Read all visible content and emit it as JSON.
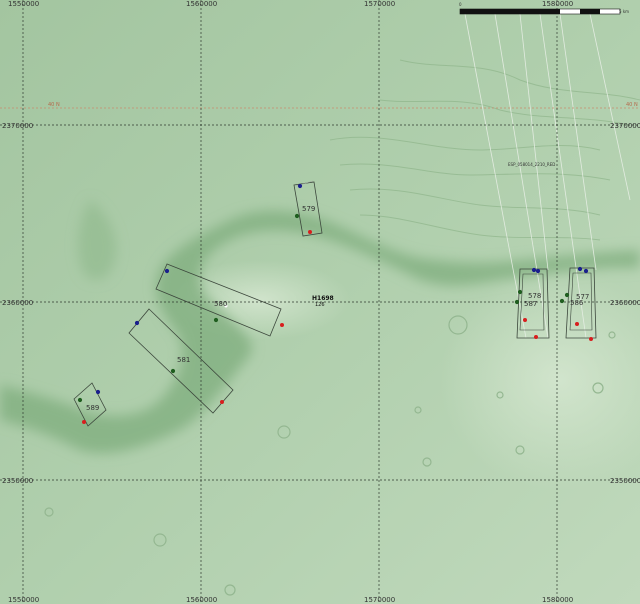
{
  "map": {
    "grid_x_labels": [
      "1550000",
      "1560000",
      "1570000",
      "1580000"
    ],
    "grid_y_labels": [
      "2370000",
      "2360000",
      "2350000"
    ],
    "latitude_label": "40 N",
    "scale_label": "0",
    "scale_end_label": "5 km",
    "center_label": "H1698",
    "center_sublabel": "126",
    "strip_label": "ESP_058014_2210_RED",
    "footprints": [
      {
        "label": "579"
      },
      {
        "label": "580"
      },
      {
        "label": "581"
      },
      {
        "label": "589"
      },
      {
        "label": "578"
      },
      {
        "label": "587"
      },
      {
        "label": "577"
      },
      {
        "label": "586"
      }
    ],
    "colors": {
      "terrain": "#a9c9a6",
      "grid": "#2f3a2f",
      "latitude_line": "#c98a6c",
      "start_dot": "#1a1f8c",
      "mid_dot": "#1f5e1f",
      "end_dot": "#d81e1e"
    }
  }
}
